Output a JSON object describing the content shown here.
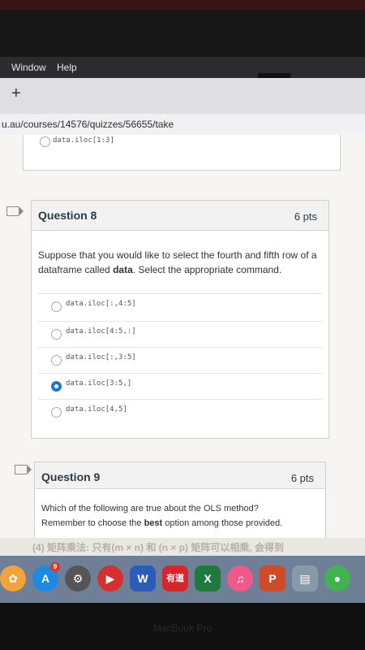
{
  "menubar": {
    "items": [
      "Window",
      "Help"
    ]
  },
  "tabs": {
    "new_tab": "+"
  },
  "address": {
    "url": "u.au/courses/14576/quizzes/56655/take"
  },
  "prev_question": {
    "last_option": "data.iloc[1:3]"
  },
  "question8": {
    "title": "Question 8",
    "points": "6 pts",
    "text_part1": "Suppose that you would like to select the fourth and fifth row of a dataframe called ",
    "text_bold": "data",
    "text_part2": ".  Select the appropriate command.",
    "options": [
      {
        "label": "data.iloc[:,4:5]",
        "selected": false
      },
      {
        "label": "data.iloc[4:5,:]",
        "selected": false
      },
      {
        "label": "data.iloc[:,3:5]",
        "selected": false
      },
      {
        "label": "data.iloc[3:5,]",
        "selected": true
      },
      {
        "label": "data.iloc[4,5]",
        "selected": false
      }
    ]
  },
  "question9": {
    "title": "Question 9",
    "points": "6 pts",
    "line1": "Which of the following are true about the OLS method?",
    "line2_part1": "Remember to choose the ",
    "line2_bold": "best",
    "line2_part2": " option among those provided."
  },
  "book_text": "(4) 矩阵乘法: 只有(m × n) 和 (n × p) 矩阵可以相乘, 会得到",
  "dock": {
    "icons": [
      {
        "name": "photos",
        "glyph": "✿",
        "color": "#f2a33a"
      },
      {
        "name": "app-store",
        "glyph": "A",
        "color": "#1e88e5",
        "badge": "9"
      },
      {
        "name": "system-preferences",
        "glyph": "⚙",
        "color": "#555555"
      },
      {
        "name": "quicktime",
        "glyph": "▶",
        "color": "#d33030"
      },
      {
        "name": "word",
        "glyph": "W",
        "color": "#2b5cb8"
      },
      {
        "name": "youdao",
        "glyph": "有道",
        "color": "#d7262b"
      },
      {
        "name": "excel",
        "glyph": "X",
        "color": "#1f7a3e"
      },
      {
        "name": "music",
        "glyph": "♫",
        "color": "#f05a8a"
      },
      {
        "name": "powerpoint",
        "glyph": "P",
        "color": "#d04a25"
      },
      {
        "name": "preview",
        "glyph": "▤",
        "color": "#8899aa"
      },
      {
        "name": "wechat",
        "glyph": "●",
        "color": "#3fb34f"
      }
    ]
  },
  "laptop_brand": "MacBook Pro"
}
